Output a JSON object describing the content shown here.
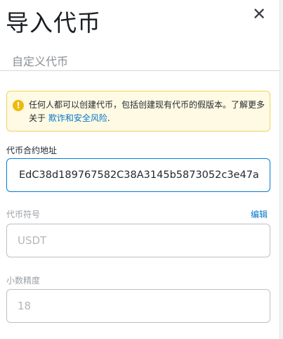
{
  "header": {
    "title": "导入代币",
    "close_icon": "✕"
  },
  "tabs": {
    "custom_token_label": "自定义代币"
  },
  "warning": {
    "icon": "!",
    "text": "任何人都可以创建代币，包括创建现有代币的假版本。了解更多关于 ",
    "link": "欺诈和安全风险",
    "suffix": "."
  },
  "form": {
    "address_label": "代币合约地址",
    "address_value": "EdC38d189767582C38A3145b5873052c3e47a",
    "symbol_label": "代币符号",
    "symbol_edit": "编辑",
    "symbol_placeholder": "USDT",
    "decimals_label": "小数精度",
    "decimals_placeholder": "18"
  },
  "colors": {
    "accent": "#037dd6",
    "warning_bg": "#fefae4",
    "warning_border": "#f0d25c",
    "warning_icon": "#f0b90b",
    "link": "#0376c9"
  }
}
